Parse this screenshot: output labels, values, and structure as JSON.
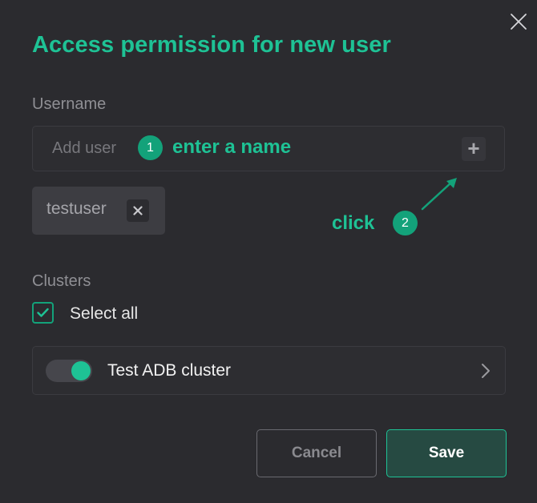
{
  "dialog": {
    "title": "Access permission for new user"
  },
  "username": {
    "label": "Username",
    "input_placeholder": "Add user",
    "input_value": "",
    "add_button_label": "+",
    "added_users": [
      {
        "name": "testuser",
        "remove_icon": "close-icon"
      }
    ]
  },
  "annotations": {
    "step1_number": "1",
    "step1_text": "enter a name",
    "step2_number": "2",
    "step2_text": "click"
  },
  "clusters": {
    "label": "Clusters",
    "select_all_label": "Select all",
    "select_all_checked": true,
    "items": [
      {
        "name": "Test ADB cluster",
        "enabled": true,
        "chevron_icon": "chevron-right-icon"
      }
    ]
  },
  "footer": {
    "cancel_label": "Cancel",
    "save_label": "Save"
  },
  "colors": {
    "background": "#2b2b2f",
    "accent": "#1ec295",
    "annotation_badge": "#13a27a",
    "save_button_bg": "#264a42"
  }
}
